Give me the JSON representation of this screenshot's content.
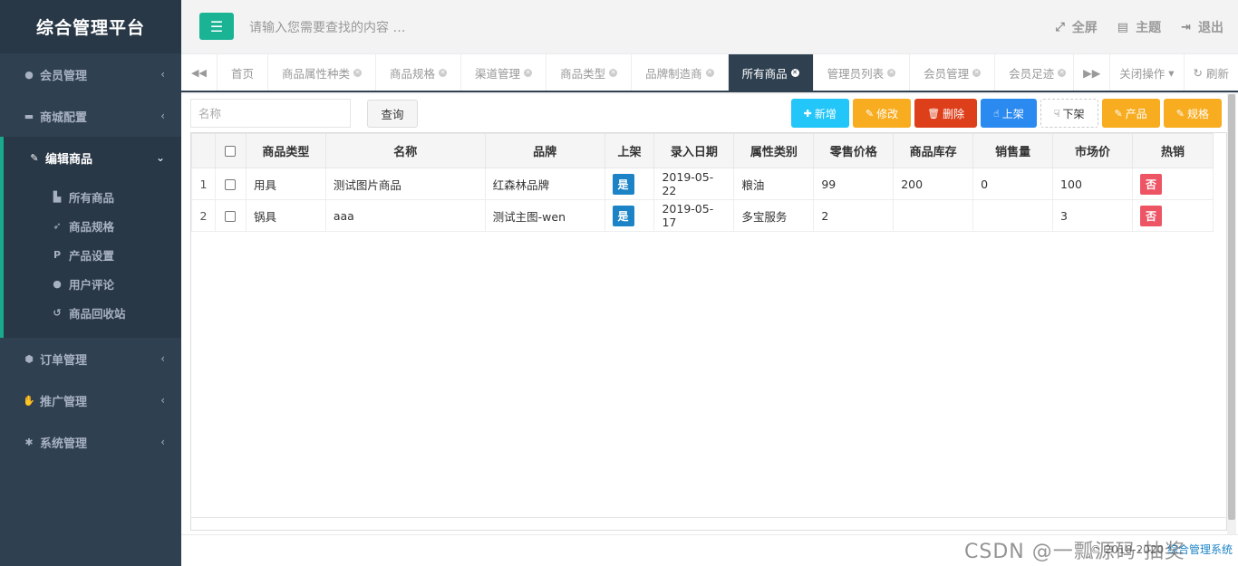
{
  "brand": "综合管理平台",
  "sidebar": {
    "items": [
      {
        "label": "会员管理",
        "icon": "user-circle-icon"
      },
      {
        "label": "商城配置",
        "icon": "cart-icon"
      },
      {
        "label": "编辑商品",
        "icon": "edit-icon",
        "expanded": true,
        "children": [
          {
            "label": "所有商品",
            "icon": "building-icon"
          },
          {
            "label": "商品规格",
            "icon": "rocket-icon"
          },
          {
            "label": "产品设置",
            "icon": "paypal-icon"
          },
          {
            "label": "用户评论",
            "icon": "comment-icon"
          },
          {
            "label": "商品回收站",
            "icon": "history-icon"
          }
        ]
      },
      {
        "label": "订单管理",
        "icon": "cube-icon"
      },
      {
        "label": "推广管理",
        "icon": "hand-icon"
      },
      {
        "label": "系统管理",
        "icon": "gear-icon"
      }
    ]
  },
  "header": {
    "search_placeholder": "请输入您需要查找的内容 …",
    "fullscreen": "全屏",
    "theme": "主题",
    "logout": "退出"
  },
  "tabs": {
    "items": [
      "首页",
      "商品属性种类",
      "商品规格",
      "渠道管理",
      "商品类型",
      "品牌制造商",
      "所有商品",
      "管理员列表",
      "会员管理",
      "会员足迹"
    ],
    "active_index": 6,
    "close_ops": "关闭操作",
    "refresh": "刷新"
  },
  "toolbar": {
    "name_placeholder": "名称",
    "query": "查询",
    "add": "新增",
    "edit": "修改",
    "delete": "删除",
    "on_shelf": "上架",
    "off_shelf": "下架",
    "product": "产品",
    "spec": "规格"
  },
  "table": {
    "columns": [
      "商品类型",
      "名称",
      "品牌",
      "上架",
      "录入日期",
      "属性类别",
      "零售价格",
      "商品库存",
      "销售量",
      "市场价",
      "热销"
    ],
    "rows": [
      {
        "no": "1",
        "type": "用具",
        "name": "测试图片商品",
        "brand": "红森林品牌",
        "on_shelf": "是",
        "date": "2019-05-22",
        "attr": "粮油",
        "price": "99",
        "stock": "200",
        "sales": "0",
        "market": "100",
        "hot": "否"
      },
      {
        "no": "2",
        "type": "锅具",
        "name": "aaa",
        "brand": "测试主图-wen",
        "on_shelf": "是",
        "date": "2019-05-17",
        "attr": "多宝服务",
        "price": "2",
        "stock": "",
        "sales": "",
        "market": "3",
        "hot": "否"
      }
    ]
  },
  "footer": {
    "copyright": "© 2018-2020",
    "link": "综合管理系统",
    "watermark": "CSDN @一瓢源码·抽奖"
  },
  "colors": {
    "sidebar_bg": "#2f4050",
    "accent": "#1ab394",
    "active_tab": "#2f4050"
  }
}
